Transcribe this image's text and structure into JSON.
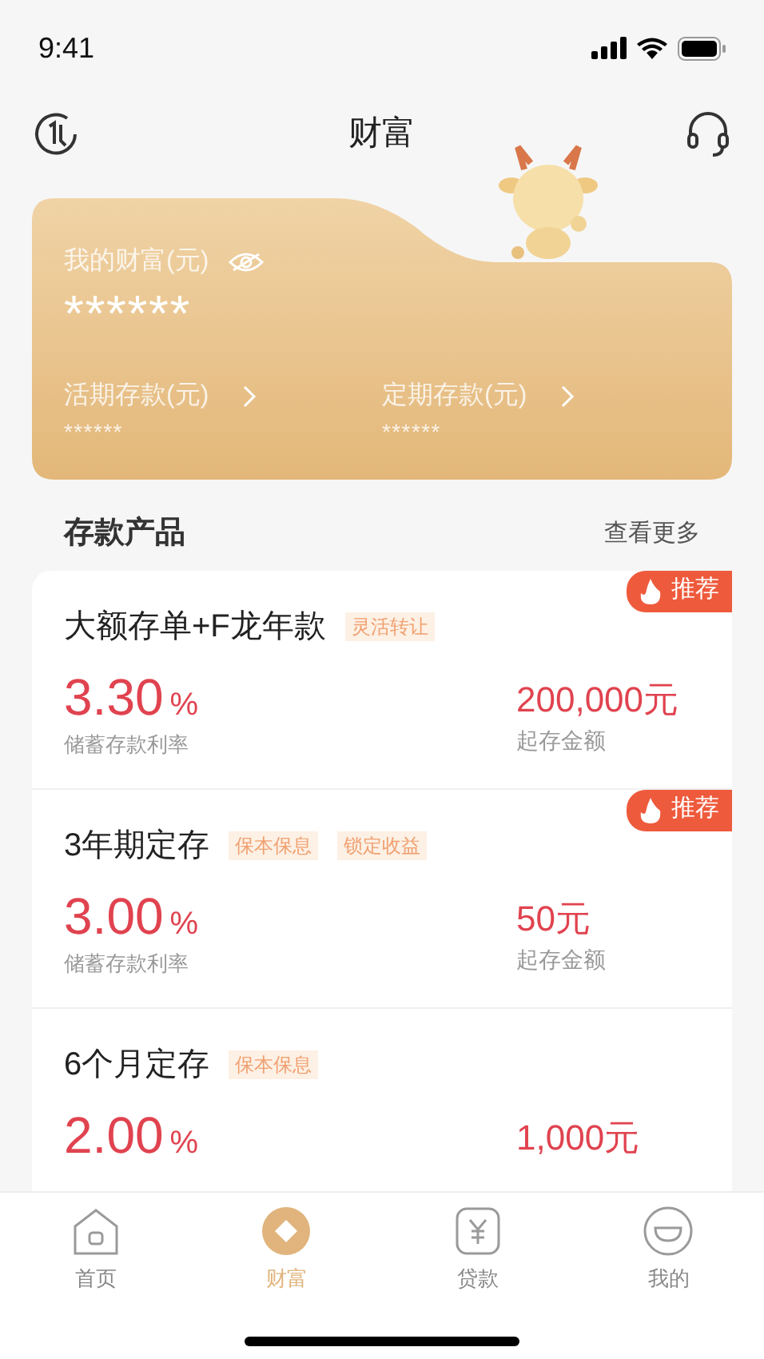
{
  "status_bar": {
    "time": "9:41"
  },
  "header": {
    "title": "财富"
  },
  "wealth_card": {
    "label": "我的财富(元)",
    "value": "******",
    "hidden": true,
    "accounts": [
      {
        "label": "活期存款(元)",
        "value": "******"
      },
      {
        "label": "定期存款(元)",
        "value": "******"
      }
    ]
  },
  "section": {
    "title": "存款产品",
    "more": "查看更多"
  },
  "products": [
    {
      "name": "大额存单+F龙年款",
      "tags": [
        "灵活转让"
      ],
      "badge": "推荐",
      "rate": "3.30",
      "unit": "%",
      "rate_label": "储蓄存款利率",
      "amount": "200,000元",
      "amount_label": "起存金额"
    },
    {
      "name": "3年期定存",
      "tags": [
        "保本保息",
        "锁定收益"
      ],
      "badge": "推荐",
      "rate": "3.00",
      "unit": "%",
      "rate_label": "储蓄存款利率",
      "amount": "50元",
      "amount_label": "起存金额"
    },
    {
      "name": "6个月定存",
      "tags": [
        "保本保息"
      ],
      "rate": "2.00",
      "unit": "%",
      "amount": "1,000元"
    }
  ],
  "tab_bar": [
    {
      "label": "首页",
      "kind": "home",
      "selected": false
    },
    {
      "label": "财富",
      "kind": "wealth",
      "selected": true
    },
    {
      "label": "贷款",
      "kind": "loan",
      "selected": false
    },
    {
      "label": "我的",
      "kind": "me",
      "selected": false
    }
  ]
}
